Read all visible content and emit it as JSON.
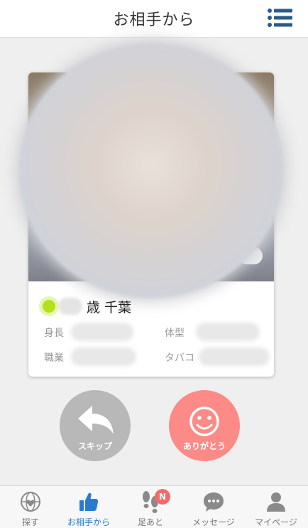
{
  "header": {
    "title": "お相手から",
    "menu_icon": "hamburger-list-icon",
    "accent_color": "#2c5a86"
  },
  "profile": {
    "online": true,
    "online_color": "#b4e21a",
    "name_suffix": "歳 千葉",
    "attributes": [
      {
        "label": "身長",
        "value": ""
      },
      {
        "label": "体型",
        "value": ""
      },
      {
        "label": "職業",
        "value": ""
      },
      {
        "label": "タバコ",
        "value": ""
      }
    ]
  },
  "actions": {
    "skip": {
      "label": "スキップ",
      "icon": "reply-arrow-icon",
      "color": "#b8b8b8"
    },
    "thanks": {
      "label": "ありがとう",
      "icon": "smiley-icon",
      "color": "#fc8b87"
    }
  },
  "tabbar": {
    "items": [
      {
        "label": "探す",
        "icon": "globe-heart-icon"
      },
      {
        "label": "お相手から",
        "icon": "thumbs-up-icon",
        "active": true
      },
      {
        "label": "足あと",
        "icon": "footprints-icon",
        "badge": "N"
      },
      {
        "label": "メッセージ",
        "icon": "chat-bubble-icon"
      },
      {
        "label": "マイページ",
        "icon": "person-icon"
      }
    ],
    "active_color": "#2a7ad0"
  }
}
